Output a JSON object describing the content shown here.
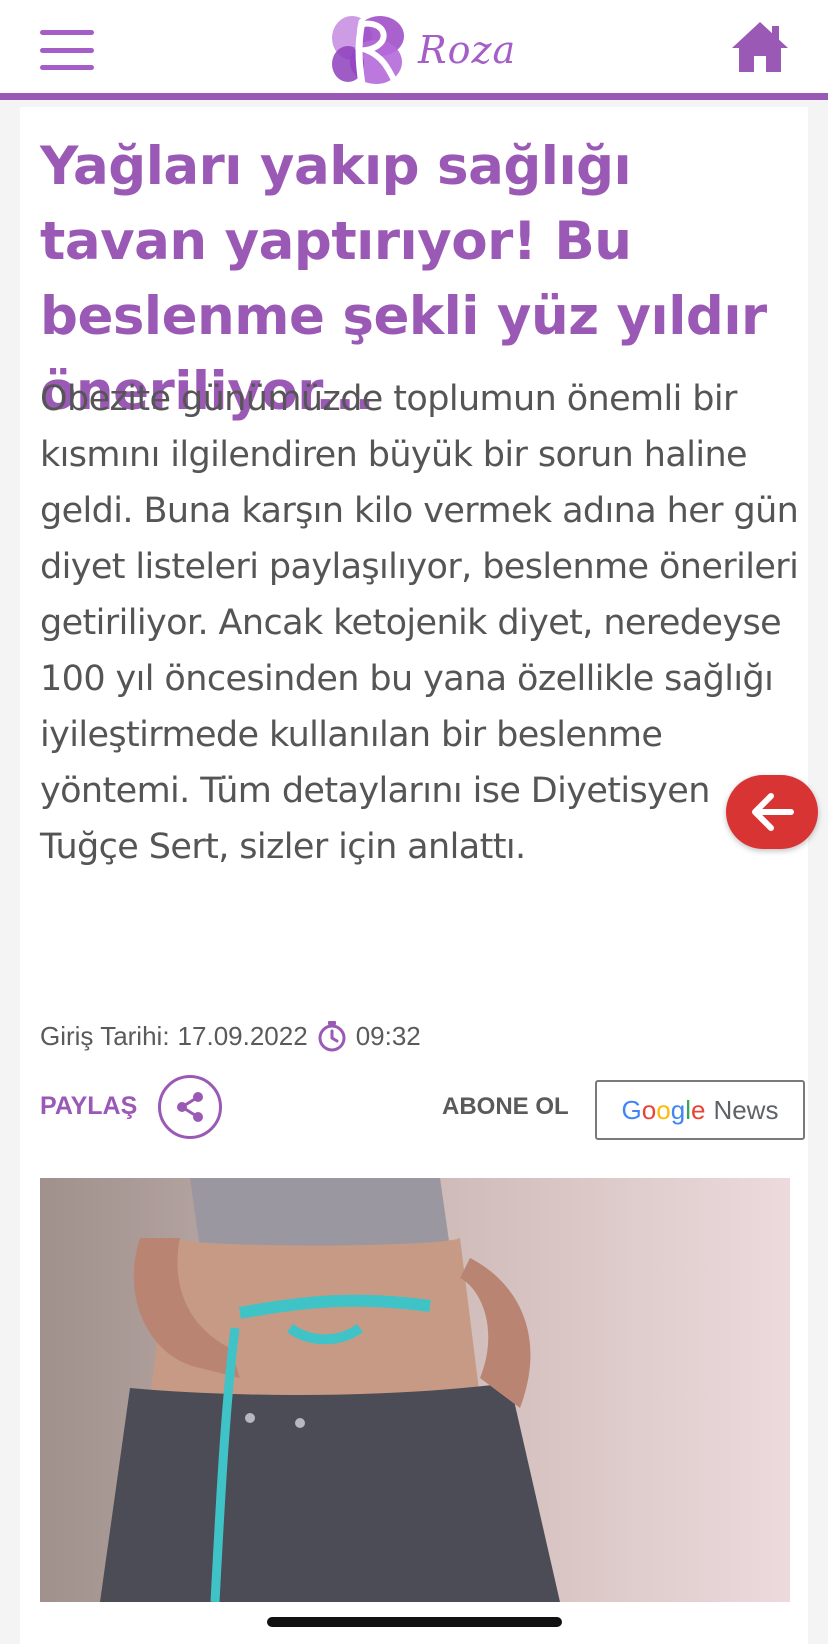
{
  "header": {
    "menu_icon": "hamburger-menu-icon",
    "logo_text": "Roza",
    "home_icon": "home-icon",
    "accent_color": "#9b59b6"
  },
  "article": {
    "title": "Yağları yakıp sağlığı tavan yaptırıyor! Bu beslenme şekli yüz yıldır öneriliyor...",
    "lead": "Obezite günümüzde toplumun önemli bir kısmını ilgilendiren büyük bir sorun haline geldi. Buna karşın kilo vermek adına her gün diyet listeleri paylaşılıyor, beslenme önerileri getiriliyor. Ancak ketojenik diyet, neredeyse 100 yıl öncesinden bu yana özellikle sağlığı iyileştirmede kullanılan bir beslenme yöntemi. Tüm detaylarını ise Diyetisyen Tuğçe Sert, sizler için anlattı.",
    "date_label": "Giriş Tarihi:",
    "date": "17.09.2022",
    "time": "09:32",
    "clock_icon": "clock-icon"
  },
  "actions": {
    "share_label": "PAYLAŞ",
    "share_icon": "share-icon",
    "subscribe_label": "ABONE OL",
    "google_word": "Google",
    "news_word": "News"
  },
  "floating": {
    "back_icon": "arrow-left-icon",
    "back_color": "#d93434"
  }
}
